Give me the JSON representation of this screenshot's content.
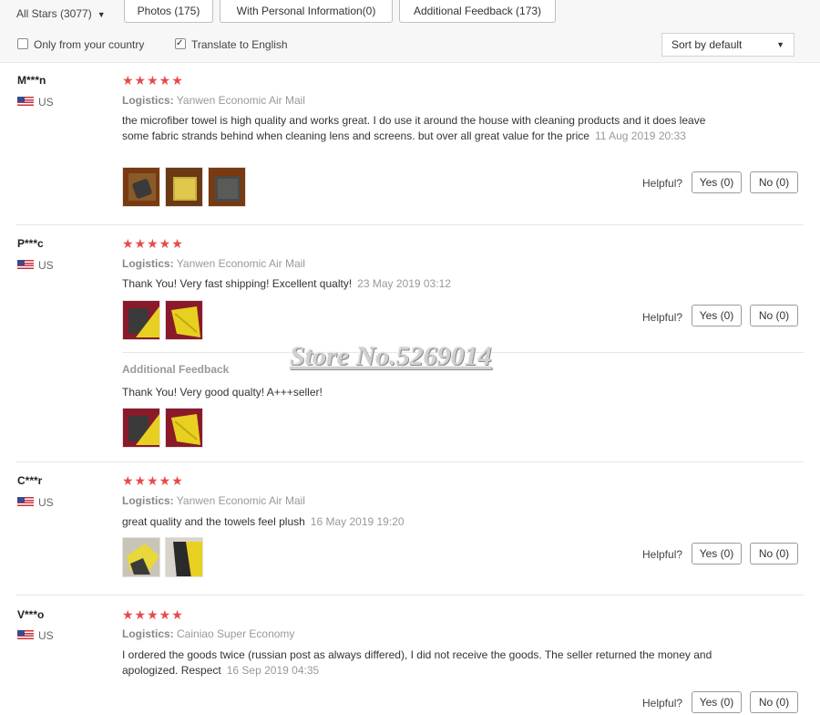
{
  "filters": {
    "all_stars": "All Stars (3077)",
    "photos": "Photos (175)",
    "personal_info": "With Personal Information(0)",
    "additional_feedback": "Additional Feedback (173)",
    "only_country": "Only from your country",
    "only_country_checked": false,
    "translate": "Translate to English",
    "translate_checked": true,
    "sort": "Sort by default"
  },
  "labels": {
    "logistics": "Logistics:",
    "helpful": "Helpful?",
    "additional_feedback": "Additional Feedback",
    "yes": "Yes (0)",
    "no": "No (0)"
  },
  "watermark": "Store No.5269014",
  "reviews": [
    {
      "user": "M***n",
      "country": "US",
      "rating": 5,
      "logistics": "Yanwen Economic Air Mail",
      "text": "the microfiber towel is high quality and works great. I do use it around the house with cleaning products and it does leave some fabric strands behind when cleaning lens and screens. but over all great value for the price",
      "date": "11 Aug 2019 20:33",
      "photos": [
        "towel-photo-1",
        "towel-photo-2",
        "towel-photo-3"
      ]
    },
    {
      "user": "P***c",
      "country": "US",
      "rating": 5,
      "logistics": "Yanwen Economic Air Mail",
      "text": "Thank You! Very fast shipping! Excellent qualty!",
      "date": "23 May 2019 03:12",
      "photos": [
        "towel-photo-1",
        "towel-photo-2"
      ],
      "additional": {
        "text": "Thank You! Very good qualty! A+++seller!",
        "photos": [
          "towel-photo-1",
          "towel-photo-2"
        ]
      }
    },
    {
      "user": "C***r",
      "country": "US",
      "rating": 5,
      "logistics": "Yanwen Economic Air Mail",
      "text": "great quality and the towels feel plush",
      "date": "16 May 2019 19:20",
      "photos": [
        "towel-photo-1",
        "towel-photo-2"
      ]
    },
    {
      "user": "V***o",
      "country": "US",
      "rating": 5,
      "logistics": "Cainiao Super Economy",
      "text": "I ordered the goods twice (russian post as always differed), I did not receive the goods. The seller returned the money and apologized. Respect",
      "date": "16 Sep 2019 04:35",
      "photos": []
    }
  ]
}
